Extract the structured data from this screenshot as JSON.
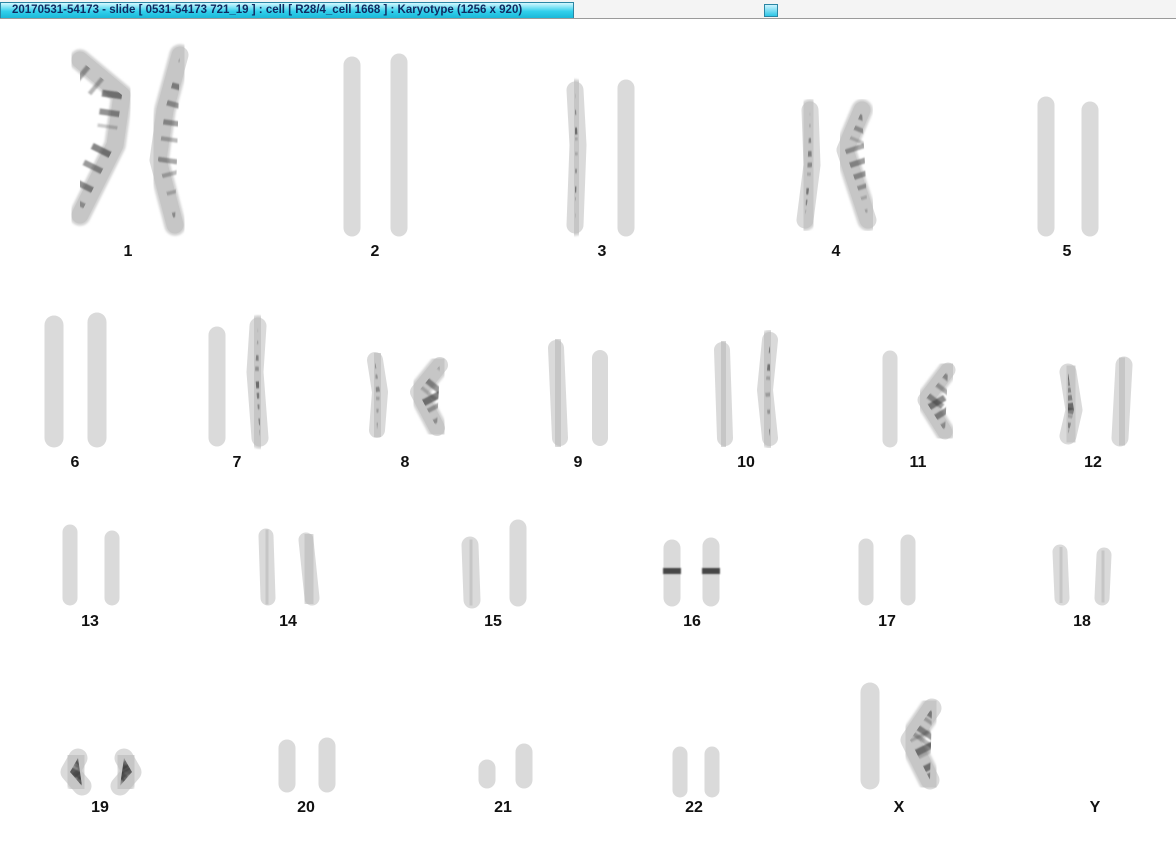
{
  "window": {
    "title": "20170531-54173 - slide [ 0531-54173 721_19 ] : cell [ R28/4_cell 1668 ] : Karyotype  (1256 x 920)"
  },
  "karyotype": {
    "labels": [
      "1",
      "2",
      "3",
      "4",
      "5",
      "6",
      "7",
      "8",
      "9",
      "10",
      "11",
      "12",
      "13",
      "14",
      "15",
      "16",
      "17",
      "18",
      "19",
      "20",
      "21",
      "22",
      "X",
      "Y"
    ]
  },
  "colors": {
    "title_tab": "#33d0ec",
    "background": "#ffffff",
    "band": "#2b2b2b",
    "chromatin": "#c8c8c8"
  }
}
